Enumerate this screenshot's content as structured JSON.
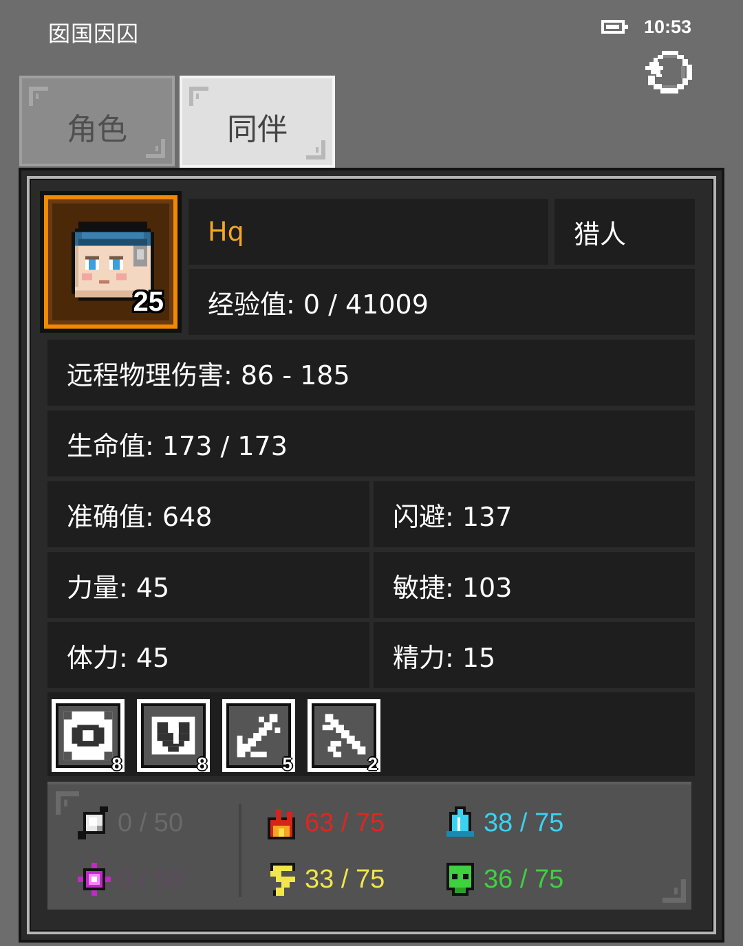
{
  "status_bar": {
    "title": "囡国因囚",
    "time": "10:53"
  },
  "tabs": [
    {
      "label": "角色"
    },
    {
      "label": "同伴"
    }
  ],
  "character": {
    "level": "25",
    "name": "Hq",
    "class": "猎人",
    "experience": "经验值: 0 / 41009",
    "damage": "远程物理伤害: 86 - 185",
    "hp": "生命值: 173 / 173",
    "accuracy": "准确值: 648",
    "evasion": "闪避: 137",
    "strength": "力量: 45",
    "agility": "敏捷: 103",
    "stamina": "体力: 45",
    "energy": "精力: 15"
  },
  "skills": [
    {
      "icon": "eye-icon",
      "count": "8"
    },
    {
      "icon": "heart-shield-icon",
      "count": "8"
    },
    {
      "icon": "arrow-volley-icon",
      "count": "5"
    },
    {
      "icon": "sword-slash-icon",
      "count": "2"
    }
  ],
  "resistances": [
    {
      "icon": "physical-crystal-icon",
      "value": "0 / 50",
      "color": "#6a6a6a"
    },
    {
      "icon": "magic-burst-icon",
      "value": "0 / 50",
      "color": "#5e4a5e"
    },
    {
      "icon": "fire-icon",
      "value": "63 / 75",
      "color": "#e0261f"
    },
    {
      "icon": "lightning-icon",
      "value": "33 / 75",
      "color": "#f2e64a"
    },
    {
      "icon": "ice-crystal-icon",
      "value": "38 / 75",
      "color": "#3ad2f0"
    },
    {
      "icon": "poison-skull-icon",
      "value": "36 / 75",
      "color": "#3ed23e"
    }
  ],
  "colors": {
    "accent_orange": "#f08a00",
    "name_color": "#f5a623"
  }
}
